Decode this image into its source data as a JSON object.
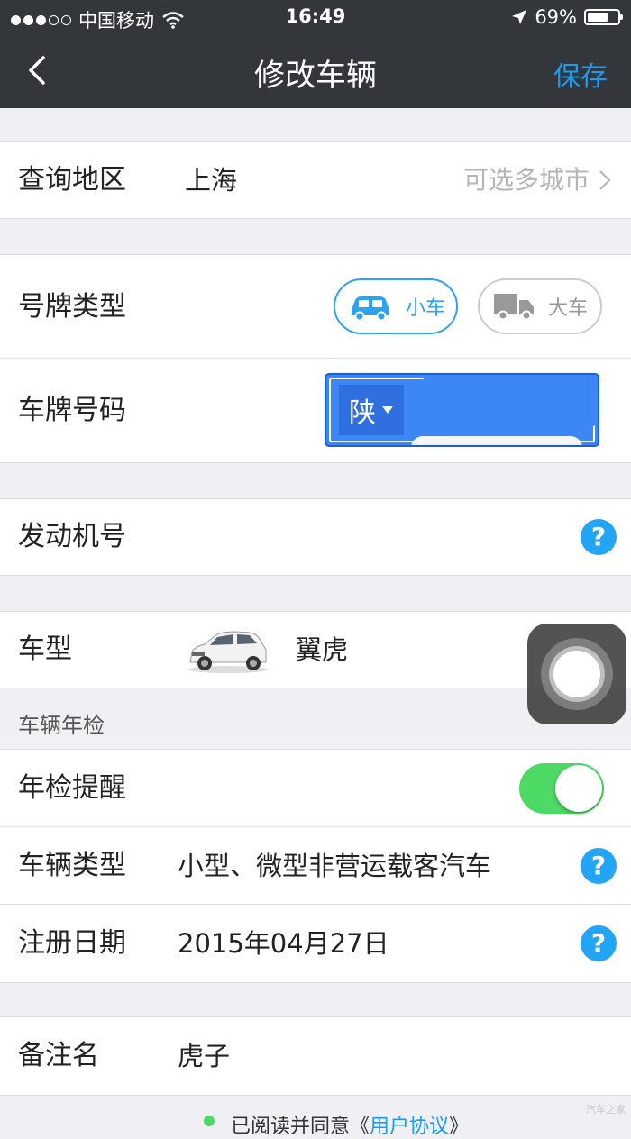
{
  "status_bar": {
    "carrier": "中国移动",
    "time": "16:49",
    "battery": "69%",
    "battery_level": 0.69
  },
  "nav": {
    "title": "修改车辆",
    "save_label": "保存"
  },
  "query_region": {
    "label": "查询地区",
    "value": "上海",
    "hint": "可选多城市"
  },
  "plate_type": {
    "label": "号牌类型",
    "options": [
      {
        "label": "小车",
        "icon": "car-icon",
        "selected": true
      },
      {
        "label": "大车",
        "icon": "truck-icon",
        "selected": false
      }
    ]
  },
  "plate_number": {
    "label": "车牌号码",
    "province": "陕"
  },
  "engine_number": {
    "label": "发动机号"
  },
  "model": {
    "label": "车型",
    "value": "翼虎"
  },
  "annual_check": {
    "section_title": "车辆年检",
    "reminder_label": "年检提醒",
    "reminder_on": true,
    "vehicle_type_label": "车辆类型",
    "vehicle_type_value": "小型、微型非营运载客汽车",
    "register_date_label": "注册日期",
    "register_date_value": "2015年04月27日"
  },
  "remark": {
    "label": "备注名",
    "value": "虎子"
  },
  "footer": {
    "text": "已阅读并同意《",
    "link": "用户协议",
    "close": "》"
  },
  "colors": {
    "accent": "#1a9cf0",
    "toggle_on": "#4cd964",
    "nav_bg": "#33373b",
    "plate_blue": "#3d86f5"
  },
  "watermark": "汽车之家"
}
